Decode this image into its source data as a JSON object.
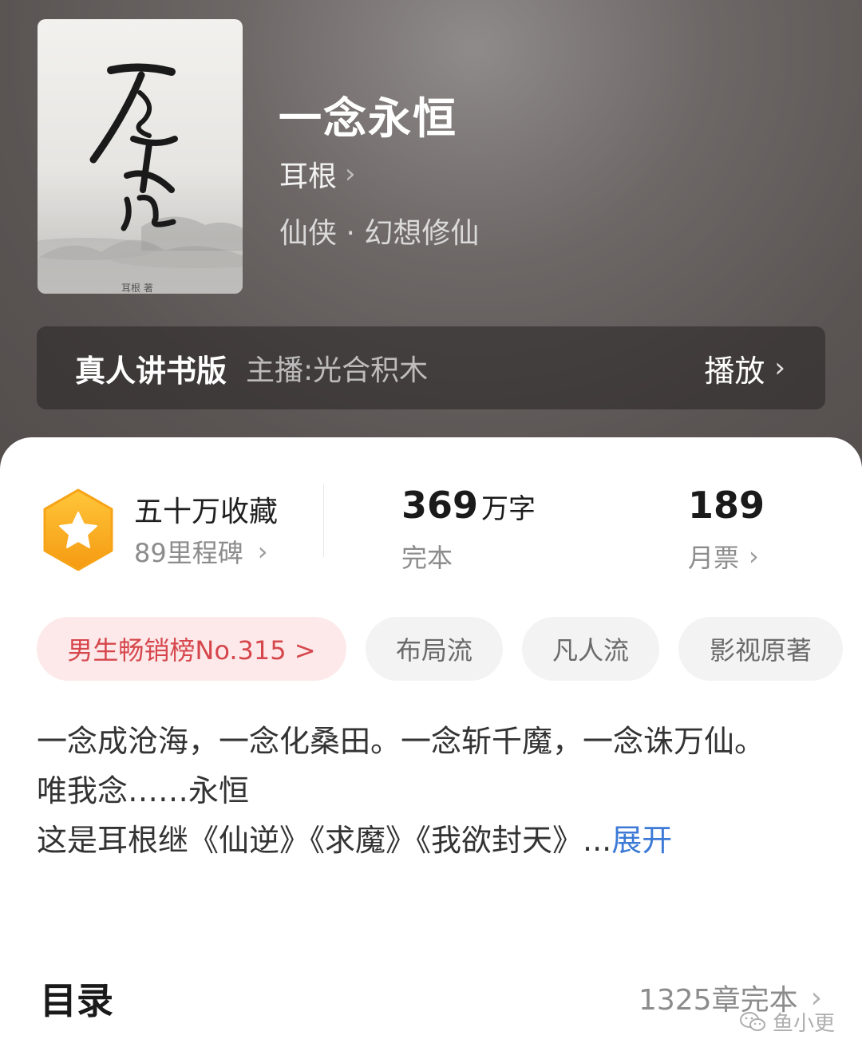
{
  "book": {
    "title": "一念永恒",
    "author": "耳根",
    "genre": "仙侠 · 幻想修仙",
    "cover_title": "一念永恒",
    "cover_author": "耳根 著"
  },
  "audio": {
    "label": "真人讲书版",
    "host": "主播:光合积木",
    "play": "播放"
  },
  "stats": {
    "favorites": "五十万收藏",
    "milestones": "89里程碑",
    "words_value": "369",
    "words_unit": "万字",
    "status": "完本",
    "votes_value": "189",
    "votes_label": "月票"
  },
  "tags": [
    {
      "label": "男生畅销榜No.315 >"
    },
    {
      "label": "布局流"
    },
    {
      "label": "凡人流"
    },
    {
      "label": "影视原著"
    }
  ],
  "description": {
    "line1": "一念成沧海，一念化桑田。一念斩千魔，一念诛万仙。",
    "line2": "唯我念……永恒",
    "line3": "这是耳根继《仙逆》《求魔》《我欲封天》...",
    "expand": "展开"
  },
  "toc": {
    "title": "目录",
    "summary": "1325章完本"
  },
  "watermark": "鱼小更",
  "icons": [
    "chevron-right-icon",
    "star-hexagon-icon",
    "wechat-icon"
  ],
  "colors": {
    "rank_red": "#d6474d",
    "rank_bg": "#fde9e9",
    "expand_blue": "#3c7ad6",
    "hex_orange": "#f7a316"
  }
}
